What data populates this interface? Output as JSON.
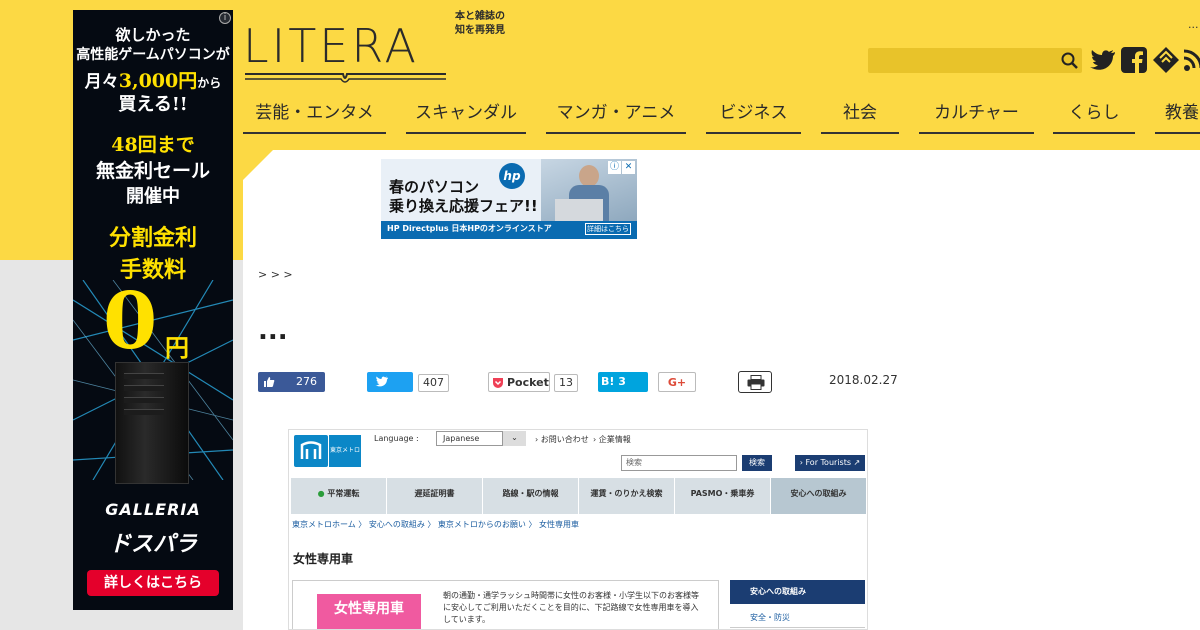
{
  "left_ad": {
    "line1": "欲しかった",
    "line2": "高性能ゲームパソコンが",
    "line3_pre": "月々",
    "line3_price": "3,000円",
    "line3_post": "から",
    "line4": "買える!!",
    "line5": "48回まで",
    "line6": "無金利セール",
    "line7": "開催中",
    "line8": "分割金利",
    "line9": "手数料",
    "zero": "0",
    "yen": "円",
    "brand": "GALLERIA",
    "brand2": "ドスパラ",
    "cta": "詳しくはこちら",
    "info": "i"
  },
  "header": {
    "logo": "LITERA",
    "tagline_1": "本と雑誌の",
    "tagline_2": "知を再発見",
    "ellipsis": "..."
  },
  "nav": {
    "items": [
      "芸能・エンタメ",
      "スキャンダル",
      "マンガ・アニメ",
      "ビジネス",
      "社会",
      "カルチャー",
      "くらし",
      "教養"
    ]
  },
  "top_ad": {
    "line1": "春のパソコン",
    "line2": "乗り換え応援フェア!!",
    "hp": "hp",
    "brand": "HP Directplus  日本HPのオンラインストア",
    "detail": "詳細はこちら",
    "info": "ⓘ",
    "close": "✕"
  },
  "breadcrumb": " > > > ",
  "article": {
    "title": "...",
    "date": "2018.02.27"
  },
  "share": {
    "facebook_count": "276",
    "twitter_count": "407",
    "pocket_label": "Pocket",
    "pocket_count": "13",
    "hatena_label": "B! 3",
    "gplus_label": "G+"
  },
  "metro": {
    "logo_text": "東京メトロ",
    "language_label": "Language :",
    "language_value": "Japanese",
    "select_arrow": "⌄",
    "link_contact": "› お問い合わせ",
    "link_company": "› 企業情報",
    "search_placeholder": "検索",
    "search_button": "検索",
    "tourists": "› For Tourists ↗",
    "nav": [
      "平常運転",
      "遅延証明書",
      "路線・駅の情報",
      "運賃・のりかえ検索",
      "PASMO・乗車券",
      "安心への取組み"
    ],
    "crumb": "東京メトロホーム  〉 安心への取組み  〉 東京メトロからのお願い  〉 女性専用車",
    "heading": "女性専用車",
    "badge": "女性専用車",
    "desc": "朝の通勤・通学ラッシュ時間帯に女性のお客様・小学生以下のお客様等に安心してご利用いただくことを目的に、下記路線で女性専用車を導入しています。",
    "side_heading": "安心への取組み",
    "side_item": "安全・防災"
  }
}
